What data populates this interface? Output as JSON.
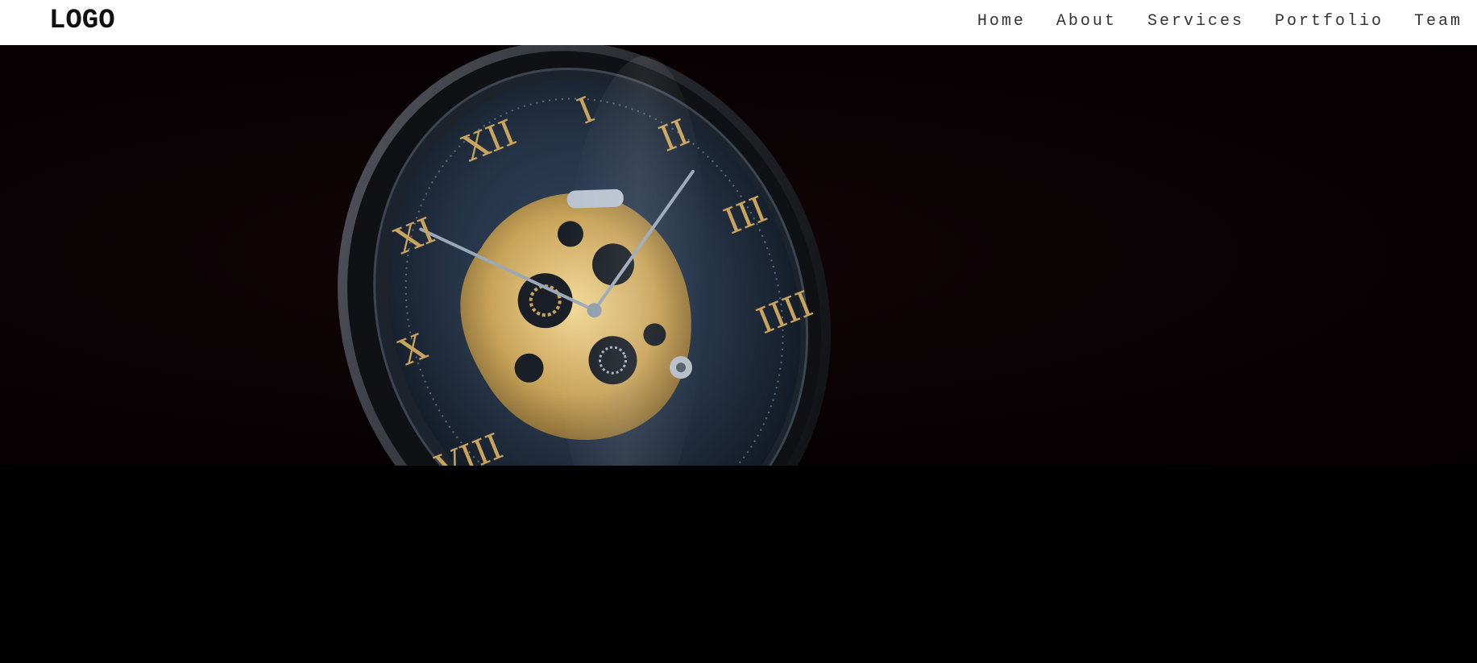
{
  "header": {
    "logo": "LOGO",
    "nav": [
      {
        "label": "Home"
      },
      {
        "label": "About"
      },
      {
        "label": "Services"
      },
      {
        "label": "Portfolio"
      },
      {
        "label": "Team"
      }
    ]
  },
  "hero": {
    "image": "pocket-watch-photo",
    "numerals": [
      "XII",
      "I",
      "II",
      "III",
      "IIII",
      "X",
      "XI",
      "VIII"
    ]
  },
  "colors": {
    "nav_background": "#ffffff",
    "page_background": "#000000",
    "dial_gold": "#c9a45a"
  }
}
